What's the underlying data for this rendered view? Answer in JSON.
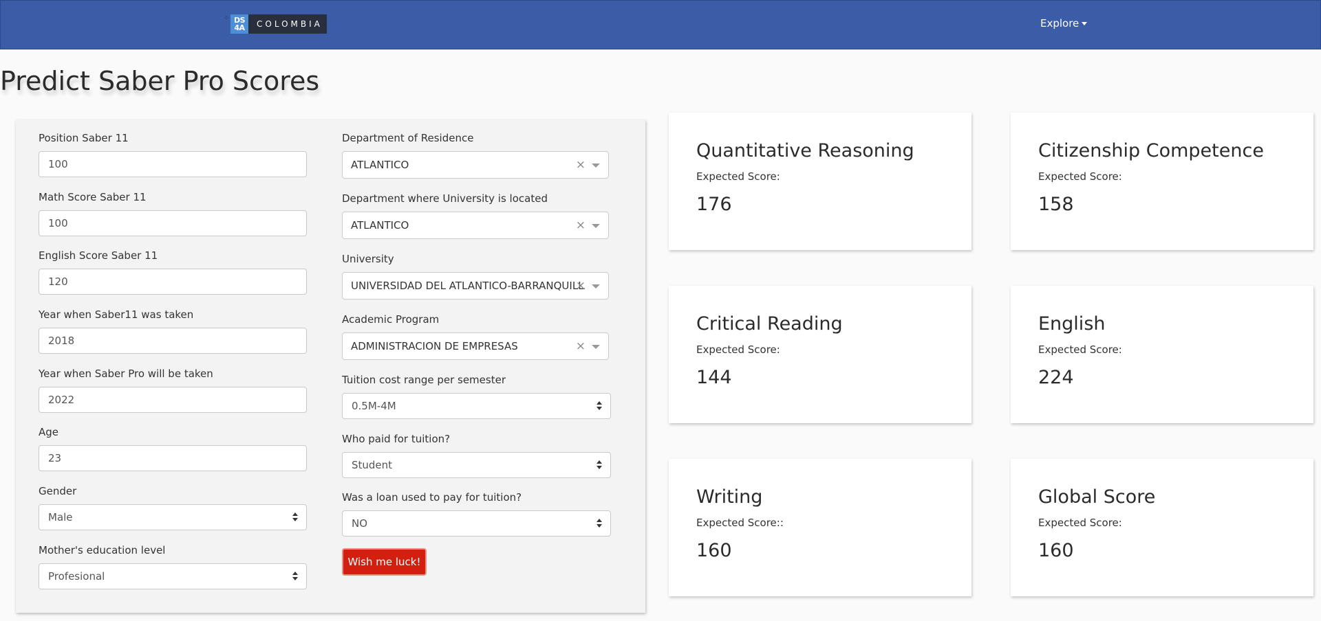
{
  "navbar": {
    "logo_box": "DS 4A",
    "logo_text": "COLOMBIA",
    "explore_label": "Explore"
  },
  "page": {
    "title": "Predict Saber Pro Scores"
  },
  "form": {
    "position_saber11": {
      "label": "Position Saber 11",
      "value": "100"
    },
    "math_saber11": {
      "label": "Math Score Saber 11",
      "value": "100"
    },
    "english_saber11": {
      "label": "English Score Saber 11",
      "value": "120"
    },
    "year_saber11": {
      "label": "Year when Saber11 was taken",
      "value": "2018"
    },
    "year_saberpro": {
      "label": "Year when Saber Pro will be taken",
      "value": "2022"
    },
    "age": {
      "label": "Age",
      "value": "23"
    },
    "gender": {
      "label": "Gender",
      "value": "Male"
    },
    "mother_education": {
      "label": "Mother's education level",
      "value": "Profesional"
    },
    "department_residence": {
      "label": "Department of Residence",
      "value": "ATLANTICO"
    },
    "department_university": {
      "label": "Department where University is located",
      "value": "ATLANTICO"
    },
    "university": {
      "label": "University",
      "value": "UNIVERSIDAD DEL ATLANTICO-BARRANQUILLA"
    },
    "academic_program": {
      "label": "Academic Program",
      "value": "ADMINISTRACION DE EMPRESAS"
    },
    "tuition_range": {
      "label": "Tuition cost range per semester",
      "value": "0.5M-4M"
    },
    "tuition_payer": {
      "label": "Who paid for tuition?",
      "value": "Student"
    },
    "tuition_loan": {
      "label": "Was a loan used to pay for tuition?",
      "value": "NO"
    },
    "submit_label": "Wish me luck!"
  },
  "scores": [
    {
      "name": "Quantitative Reasoning",
      "sub": "Expected Score:",
      "value": "176"
    },
    {
      "name": "Citizenship Competence",
      "sub": "Expected Score:",
      "value": "158"
    },
    {
      "name": "Critical Reading",
      "sub": "Expected Score:",
      "value": "144"
    },
    {
      "name": "English",
      "sub": "Expected Score:",
      "value": "224"
    },
    {
      "name": "Writing",
      "sub": "Expected Score::",
      "value": "160"
    },
    {
      "name": "Global Score",
      "sub": "Expected Score:",
      "value": "160"
    }
  ]
}
